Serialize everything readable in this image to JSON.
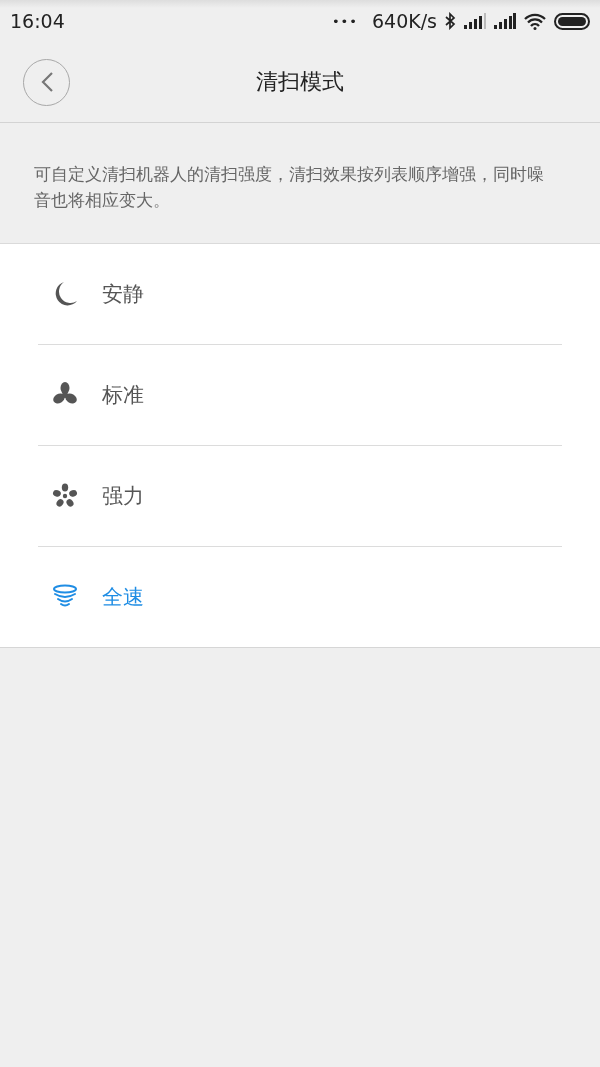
{
  "status_bar": {
    "time": "16:04",
    "dots": "•••",
    "speed": "640K/s"
  },
  "header": {
    "title": "清扫模式"
  },
  "description": "可自定义清扫机器人的清扫强度，清扫效果按列表顺序增强，同时噪音也将相应变大。",
  "modes": [
    {
      "kind": "moon",
      "label": "安静",
      "selected": false
    },
    {
      "kind": "fan3",
      "label": "标准",
      "selected": false
    },
    {
      "kind": "fan5",
      "label": "强力",
      "selected": false
    },
    {
      "kind": "cyclone",
      "label": "全速",
      "selected": true
    }
  ]
}
